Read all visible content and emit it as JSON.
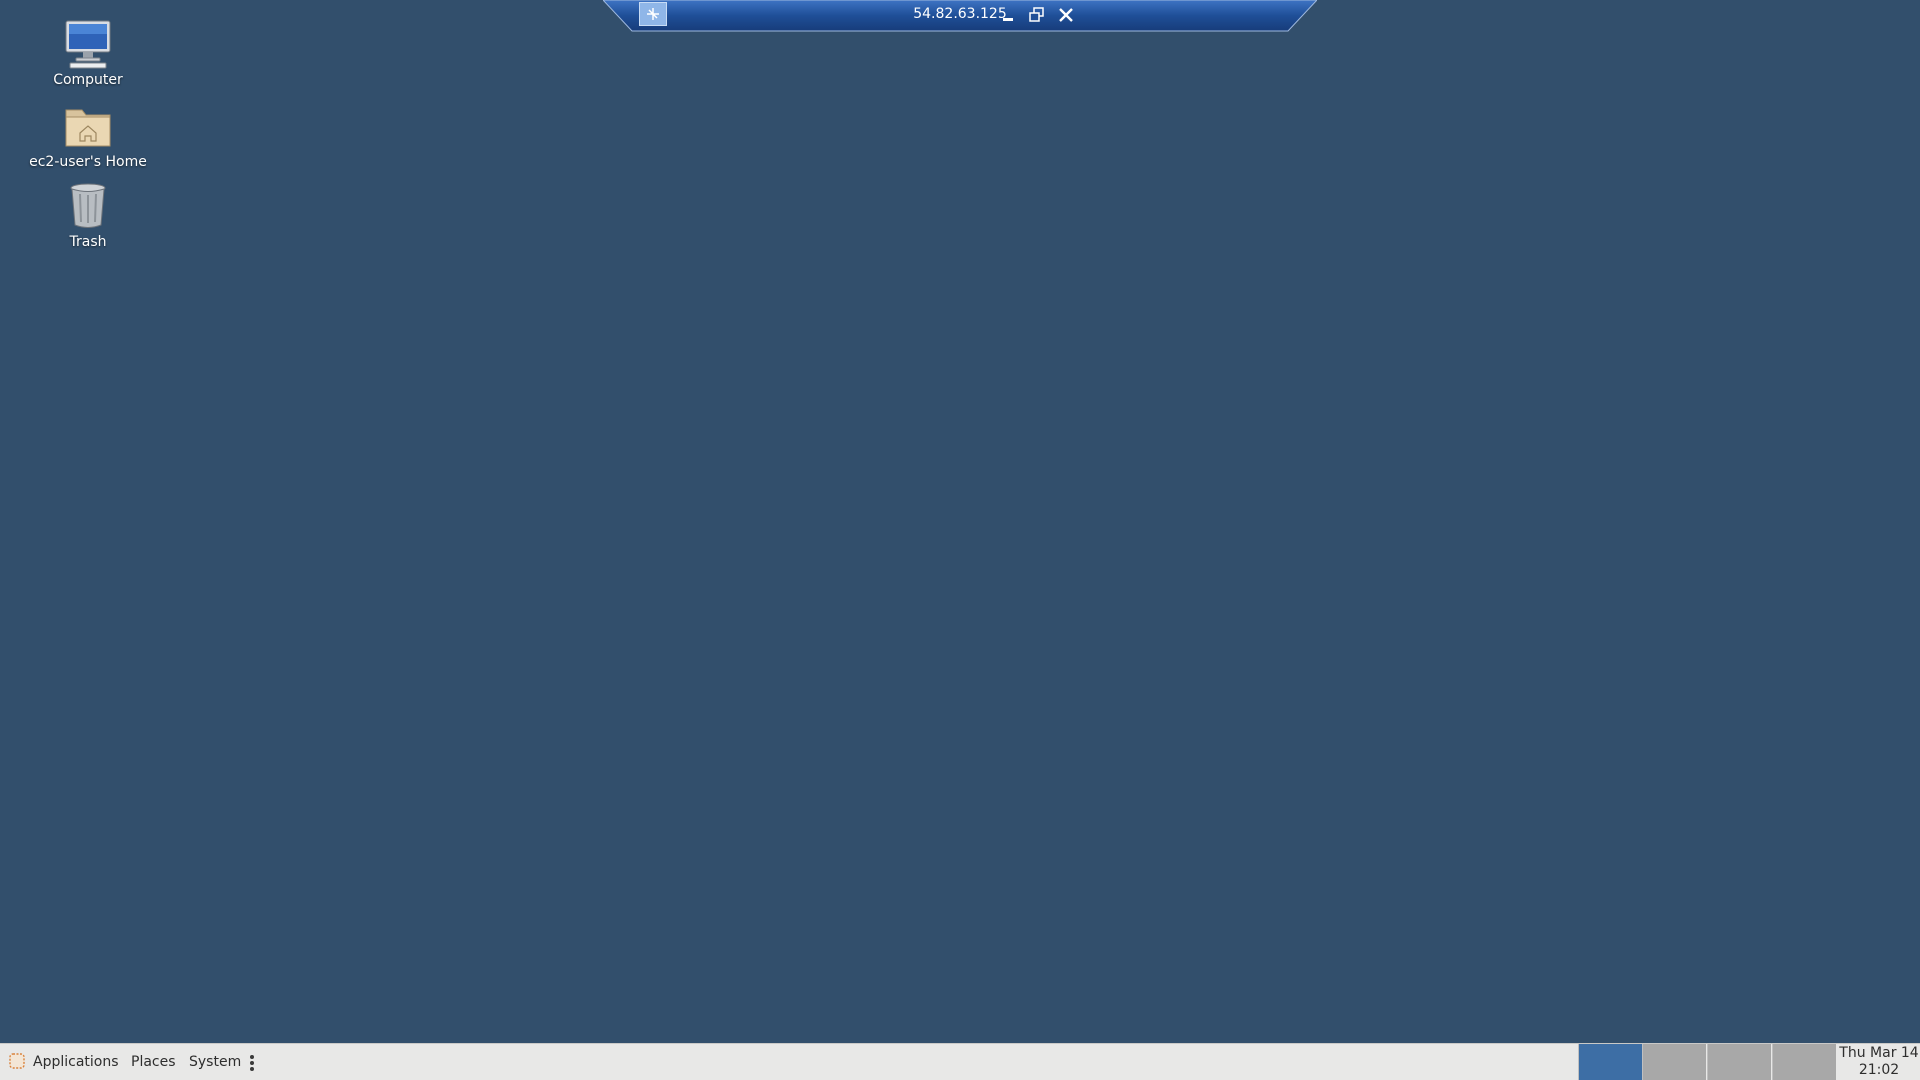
{
  "desktop": {
    "background_color": "#324f6c",
    "icons": [
      {
        "label": "Computer",
        "icon": "computer-icon"
      },
      {
        "label": "ec2-user's Home",
        "icon": "home-folder-icon"
      },
      {
        "label": "Trash",
        "icon": "trash-icon"
      }
    ]
  },
  "connection_bar": {
    "title": "54.82.63.125",
    "buttons": [
      "pin-icon",
      "minimize-icon",
      "restore-icon",
      "close-icon"
    ],
    "accent": "#1f4f98"
  },
  "panel": {
    "menus": {
      "applications": "Applications",
      "places": "Places",
      "system": "System"
    },
    "workspaces": [
      {
        "active": true
      },
      {
        "active": false
      },
      {
        "active": false
      },
      {
        "active": false
      }
    ],
    "clock": {
      "date": "Thu Mar 14",
      "time": "21:02"
    }
  }
}
